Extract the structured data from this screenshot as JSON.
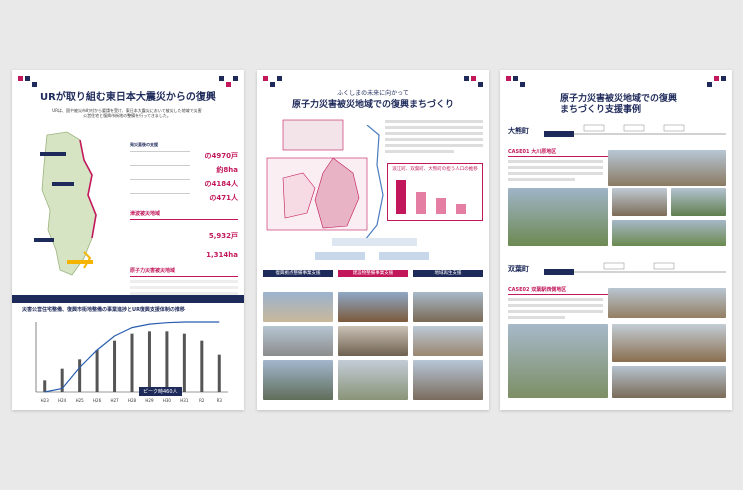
{
  "panel1": {
    "title": "URが取り組む東日本大震災からの復興",
    "subtitle": "URは、国や被災市町村から要請を受け、東日本大震災において被災した地域で災害公営住宅と復興市街地の整備を行ってきました。",
    "support_header": "発災直後の支援",
    "stats": [
      {
        "label": "",
        "value": "の4970戸"
      },
      {
        "label": "",
        "value": "約8ha"
      },
      {
        "label": "",
        "value": "の4184人"
      },
      {
        "label": "",
        "value": "の471人"
      }
    ],
    "tsunami_header": "津波被災地域",
    "tsunami_values": [
      "5,932戸",
      "1,314ha"
    ],
    "nuclear_header": "原子力災害被災地域",
    "chart_title": "災害公営住宅整備、復興市街地整備の事業進捗とUR復興支援体制の推移",
    "chart_note": "ピーク時460人",
    "colors": {
      "navy": "#1e2a5a",
      "magenta": "#c2185b",
      "yellow": "#f5b400"
    }
  },
  "panel2": {
    "kicker": "ふくしまの未来に向かって",
    "title": "原子力災害被災地域での復興まちづくり",
    "box": "浪江町、双葉町、大熊町の担う人口の推移",
    "sections": [
      "復興拠点整備事業支援",
      "建設物整備事業支援",
      "地域再生支援"
    ]
  },
  "panel3": {
    "title": "原子力災害被災地域での復興まちづくり支援事例",
    "town1": "大熊町",
    "case1": "CASE01 大川原地区",
    "town2": "双葉町",
    "case2": "CASE02 双葉駅西側地区"
  },
  "chart_data": {
    "type": "bar",
    "categories": [
      "H23",
      "H24",
      "H25",
      "H26",
      "H27",
      "H28",
      "H29",
      "H30",
      "H31",
      "R2",
      "R3"
    ],
    "values": [
      5,
      10,
      14,
      18,
      22,
      25,
      26,
      26,
      25,
      22,
      16
    ],
    "title": "災害公営住宅整備、復興市街地整備の事業進捗とUR復興支援体制の推移",
    "xlabel": "",
    "ylabel": "",
    "ylim": [
      0,
      30
    ],
    "line": [
      0,
      5,
      35,
      60,
      80,
      92,
      97,
      99,
      100,
      100,
      100
    ]
  }
}
